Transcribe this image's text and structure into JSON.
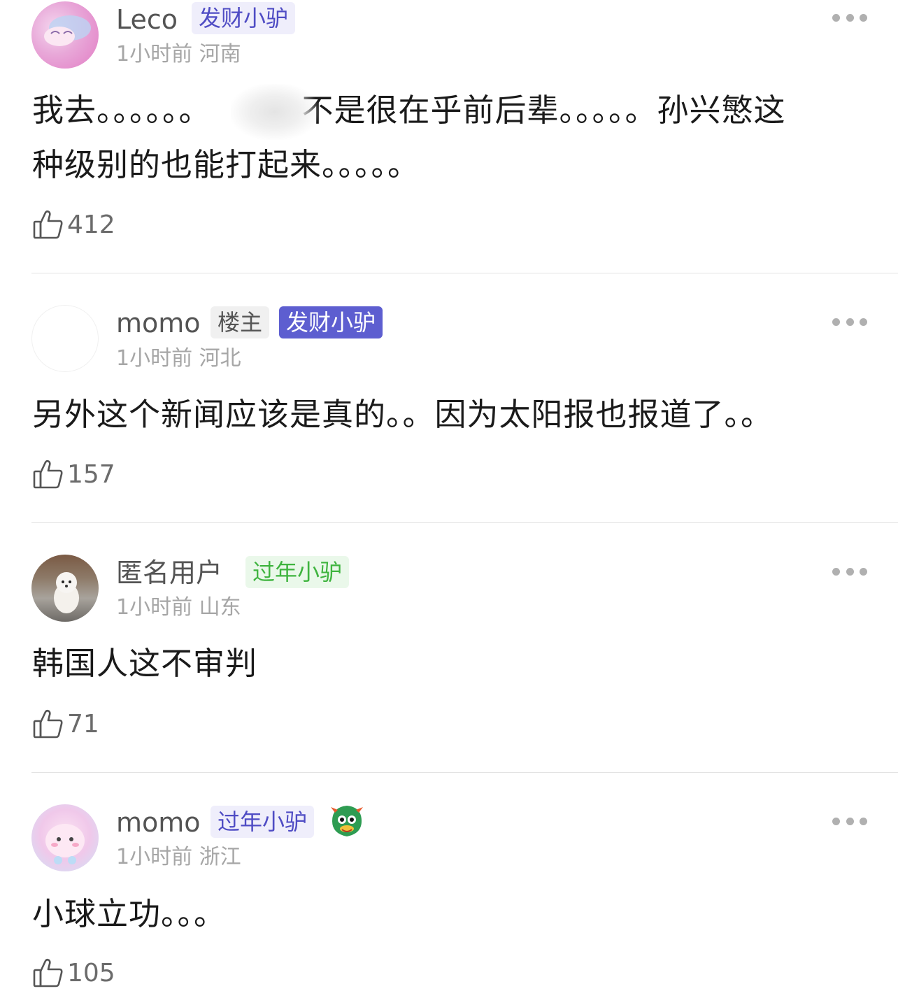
{
  "comments": [
    {
      "username": "Leco",
      "badges": [
        "发财小驴"
      ],
      "time": "1小时前",
      "location": "河南",
      "content_line1": "我去。。。。。。",
      "content_line1b": "不是很在乎前后辈。。。。。孙兴慜这",
      "content_line2": "种级别的也能打起来。。。。。",
      "likes": "412"
    },
    {
      "username": "momo",
      "badges": [
        "楼主",
        "发财小驴"
      ],
      "time": "1小时前",
      "location": "河北",
      "content": "另外这个新闻应该是真的。。因为太阳报也报道了。。",
      "likes": "157"
    },
    {
      "username": "匿名用户",
      "badges": [
        "过年小驴"
      ],
      "time": "1小时前",
      "location": "山东",
      "content": "韩国人这不审判",
      "likes": "71"
    },
    {
      "username": "momo",
      "badges": [
        "过年小驴"
      ],
      "time": "1小时前",
      "location": "浙江",
      "content": "小球立功。。。",
      "likes": "105"
    }
  ],
  "icons": {
    "like": "thumbs-up-outline-icon",
    "more": "more-horizontal-icon"
  },
  "colors": {
    "badge_purple": "#5d5ed0",
    "badge_green": "#3fb43f",
    "meta_gray": "#a6a6a6"
  }
}
